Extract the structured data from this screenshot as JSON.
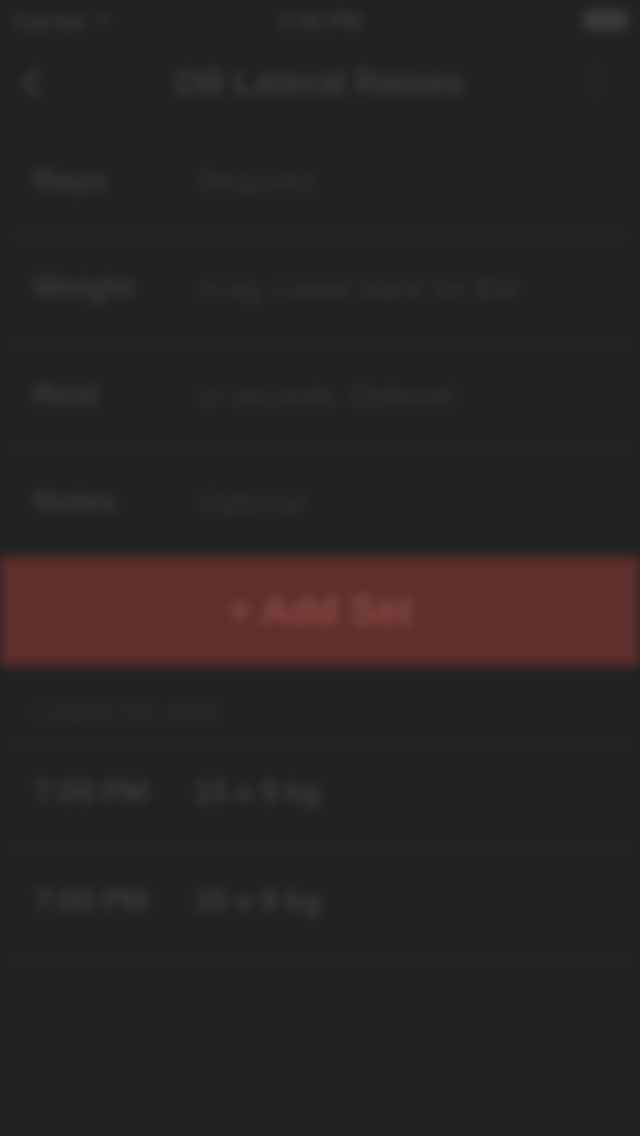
{
  "status_bar": {
    "carrier": "Carrier ⌔",
    "time": "3:56 PM",
    "battery_icon": "battery-icon"
  },
  "nav": {
    "back_icon": "chevron-left-icon",
    "title": "DB Lateral Raises",
    "more_icon": "more-vertical-icon"
  },
  "form": {
    "rows": [
      {
        "label": "Reps",
        "value": "Required"
      },
      {
        "label": "Weight",
        "value": "in kg. Leave blank for BW"
      },
      {
        "label": "Rest",
        "value": "in seconds. Optional"
      },
      {
        "label": "Notes",
        "value": "Optional"
      }
    ]
  },
  "add_set": {
    "label": "+ Add Set",
    "color": "#5e2e2a"
  },
  "history": {
    "header": "Logged this week",
    "sets": [
      {
        "time": "7:00 PM",
        "detail": "15 x 9 kg"
      },
      {
        "time": "7:00 PM",
        "detail": "15 x 9 kg"
      }
    ]
  }
}
